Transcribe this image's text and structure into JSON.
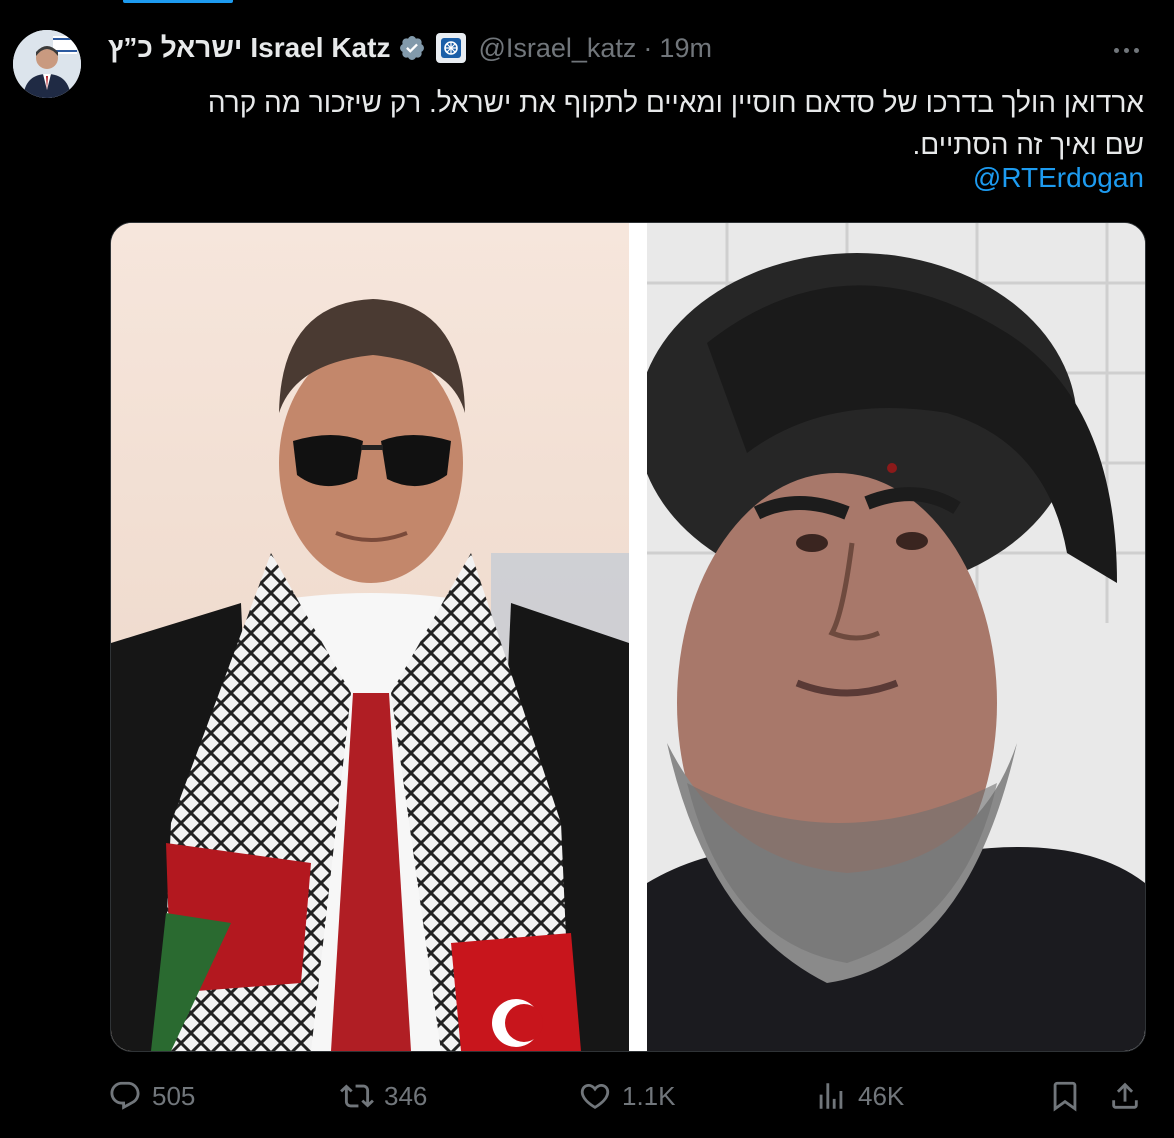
{
  "tweet": {
    "author_name": "Israel Katz",
    "author_name_hebrew": "ישראל כ”ץ",
    "handle": "@Israel_katz",
    "separator": "·",
    "time": "19m",
    "text_line1": "ארדואן הולך בדרכו של סדאם חוסיין ומאיים לתקוף את ישראל. רק שיזכור מה קרה",
    "text_line2": "שם ואיך זה הסתיים.",
    "mention": "@RTErdogan"
  },
  "actions": {
    "replies": "505",
    "reposts": "346",
    "likes": "1.1K",
    "views": "46K"
  },
  "icons": {
    "verified": "verified-badge-icon",
    "affiliation": "government-affiliation-icon",
    "more": "more-options-icon",
    "reply": "reply-icon",
    "repost": "repost-icon",
    "like": "heart-icon",
    "views": "views-icon",
    "bookmark": "bookmark-icon",
    "share": "share-icon"
  },
  "colors": {
    "background": "#000000",
    "text": "#e7e9ea",
    "muted": "#71767b",
    "link": "#1d9bf0"
  }
}
